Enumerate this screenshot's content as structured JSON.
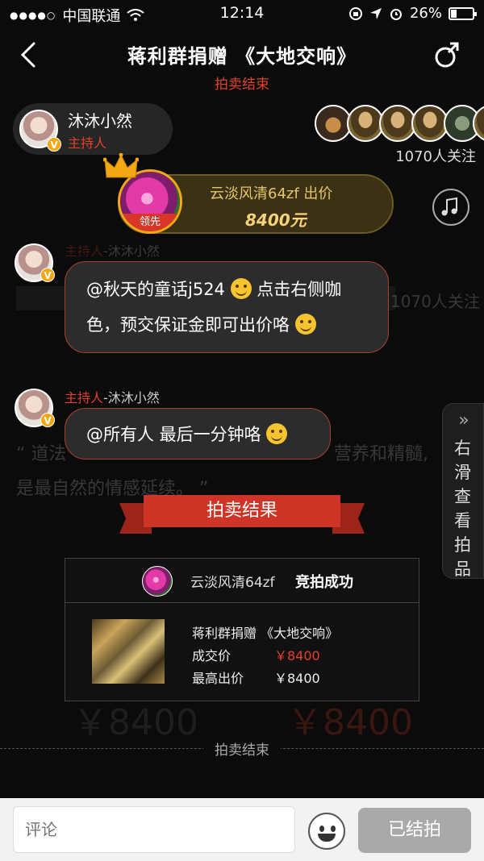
{
  "status_bar": {
    "carrier": "中国联通",
    "time": "12:14",
    "battery": "26%",
    "battery_level": 0.26
  },
  "header": {
    "title": "蒋利群捐赠 《大地交响》",
    "status": "拍卖结束"
  },
  "host": {
    "name": "沐沐小然",
    "role": "主持人",
    "badge": "V"
  },
  "followers": {
    "count_text": "1070人关注"
  },
  "leading_bid": {
    "label": "云淡风清64zf 出价",
    "amount": "8400元",
    "tag": "领先"
  },
  "messages": [
    {
      "sender_role": "主持人",
      "sender_name": "-沐沐小然",
      "text_before": "@秋天的童话j524",
      "text_after": "点击右侧咖色，预交保证金即可出价咯"
    },
    {
      "sender_role": "主持人",
      "sender_name": "-沐沐小然",
      "text": "@所有人 最后一分钟咯"
    }
  ],
  "side_tab": {
    "arrow": "»",
    "label": "右滑查看拍品"
  },
  "result": {
    "banner": "拍卖结果",
    "winner_name": "云淡风清64zf",
    "winner_status": "竞拍成功",
    "item_title": "蒋利群捐赠 《大地交响》",
    "deal_label": "成交价",
    "deal_value": "￥8400",
    "highest_label": "最高出价",
    "highest_value": "￥8400"
  },
  "ghost_text": {
    "quote_line_1": "“ 道法",
    "quote_line_1b": "营养和精髓,",
    "quote_line_2": "是最自然的情感延续。 ”",
    "price_left": "￥8400",
    "price_right": "￥8400"
  },
  "end_label": "拍卖结束",
  "bottom": {
    "comment_placeholder": "评论",
    "ended_button": "已结拍"
  },
  "colors": {
    "accent_red": "#e2412b",
    "gold": "#f6d27a"
  }
}
